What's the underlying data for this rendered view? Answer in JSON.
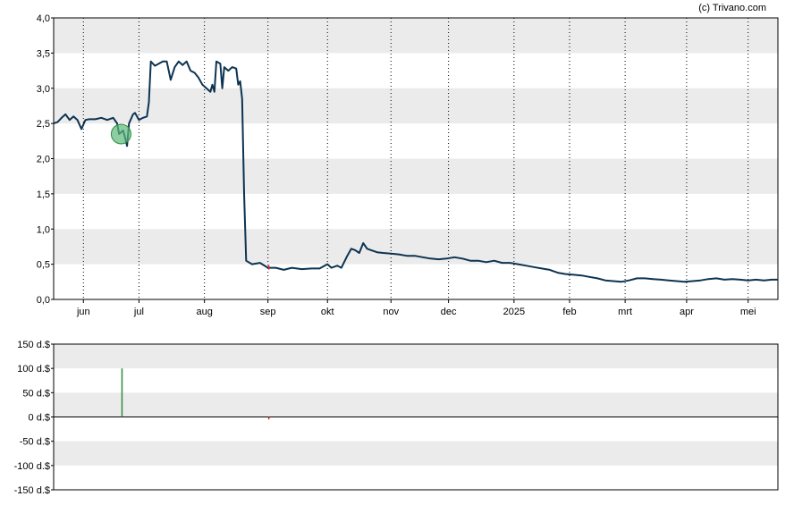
{
  "credit": "(c) Trivano.com",
  "colors": {
    "band": "#ebebeb",
    "price_line": "#0d3451",
    "positive": "#2e8b3d",
    "negative": "#e0242a",
    "marker_fill": "#5cb87a"
  },
  "chart_data": [
    {
      "type": "line",
      "name": "price",
      "ylim": [
        0,
        4
      ],
      "yticks": [
        "0,0",
        "0,5",
        "1,0",
        "1,5",
        "2,0",
        "2,5",
        "3,0",
        "3,5",
        "4,0"
      ],
      "xlim": [
        0,
        365
      ],
      "xticks": [
        {
          "label": "jun",
          "x": 15
        },
        {
          "label": "jul",
          "x": 43
        },
        {
          "label": "aug",
          "x": 76
        },
        {
          "label": "sep",
          "x": 108
        },
        {
          "label": "okt",
          "x": 138
        },
        {
          "label": "nov",
          "x": 170
        },
        {
          "label": "dec",
          "x": 199
        },
        {
          "label": "2025",
          "x": 232
        },
        {
          "label": "feb",
          "x": 260
        },
        {
          "label": "mrt",
          "x": 288
        },
        {
          "label": "apr",
          "x": 319
        },
        {
          "label": "mei",
          "x": 350
        }
      ],
      "grid": "horizontal bands, vertical dotted lines at month ticks",
      "series": [
        {
          "points": [
            [
              0,
              2.5
            ],
            [
              2,
              2.52
            ],
            [
              4,
              2.58
            ],
            [
              6,
              2.63
            ],
            [
              8,
              2.55
            ],
            [
              10,
              2.6
            ],
            [
              12,
              2.55
            ],
            [
              14,
              2.42
            ],
            [
              16,
              2.55
            ],
            [
              18,
              2.56
            ],
            [
              21,
              2.56
            ],
            [
              24,
              2.58
            ],
            [
              27,
              2.55
            ],
            [
              30,
              2.58
            ],
            [
              32,
              2.5
            ],
            [
              33,
              2.35
            ],
            [
              35,
              2.4
            ],
            [
              36,
              2.3
            ],
            [
              37,
              2.18
            ],
            [
              38,
              2.5
            ],
            [
              40,
              2.63
            ],
            [
              41,
              2.65
            ],
            [
              43,
              2.55
            ],
            [
              45,
              2.58
            ],
            [
              47,
              2.6
            ],
            [
              48,
              2.8
            ],
            [
              49,
              3.38
            ],
            [
              51,
              3.32
            ],
            [
              53,
              3.35
            ],
            [
              55,
              3.38
            ],
            [
              57,
              3.38
            ],
            [
              59,
              3.12
            ],
            [
              61,
              3.3
            ],
            [
              63,
              3.38
            ],
            [
              65,
              3.33
            ],
            [
              67,
              3.38
            ],
            [
              69,
              3.25
            ],
            [
              71,
              3.22
            ],
            [
              73,
              3.15
            ],
            [
              75,
              3.05
            ],
            [
              77,
              3.0
            ],
            [
              79,
              2.95
            ],
            [
              80,
              3.05
            ],
            [
              81,
              2.95
            ],
            [
              82,
              3.38
            ],
            [
              84,
              3.35
            ],
            [
              85,
              3.0
            ],
            [
              86,
              3.3
            ],
            [
              88,
              3.25
            ],
            [
              90,
              3.3
            ],
            [
              92,
              3.28
            ],
            [
              93,
              3.05
            ],
            [
              94,
              3.1
            ],
            [
              95,
              2.85
            ],
            [
              96,
              1.5
            ],
            [
              97,
              0.55
            ],
            [
              100,
              0.5
            ],
            [
              104,
              0.52
            ],
            [
              108,
              0.45
            ],
            [
              112,
              0.45
            ],
            [
              116,
              0.42
            ],
            [
              120,
              0.45
            ],
            [
              125,
              0.43
            ],
            [
              130,
              0.44
            ],
            [
              134,
              0.44
            ],
            [
              138,
              0.5
            ],
            [
              140,
              0.45
            ],
            [
              143,
              0.48
            ],
            [
              145,
              0.45
            ],
            [
              148,
              0.62
            ],
            [
              150,
              0.72
            ],
            [
              152,
              0.7
            ],
            [
              154,
              0.66
            ],
            [
              156,
              0.8
            ],
            [
              158,
              0.72
            ],
            [
              160,
              0.7
            ],
            [
              163,
              0.67
            ],
            [
              166,
              0.66
            ],
            [
              170,
              0.65
            ],
            [
              174,
              0.64
            ],
            [
              178,
              0.62
            ],
            [
              182,
              0.62
            ],
            [
              186,
              0.6
            ],
            [
              190,
              0.58
            ],
            [
              194,
              0.57
            ],
            [
              198,
              0.58
            ],
            [
              202,
              0.6
            ],
            [
              206,
              0.58
            ],
            [
              210,
              0.55
            ],
            [
              214,
              0.55
            ],
            [
              218,
              0.53
            ],
            [
              222,
              0.55
            ],
            [
              226,
              0.52
            ],
            [
              230,
              0.52
            ],
            [
              234,
              0.5
            ],
            [
              238,
              0.48
            ],
            [
              242,
              0.46
            ],
            [
              246,
              0.44
            ],
            [
              250,
              0.42
            ],
            [
              254,
              0.38
            ],
            [
              258,
              0.36
            ],
            [
              262,
              0.35
            ],
            [
              266,
              0.34
            ],
            [
              270,
              0.32
            ],
            [
              274,
              0.3
            ],
            [
              278,
              0.27
            ],
            [
              282,
              0.26
            ],
            [
              286,
              0.25
            ],
            [
              290,
              0.27
            ],
            [
              294,
              0.3
            ],
            [
              298,
              0.3
            ],
            [
              302,
              0.29
            ],
            [
              306,
              0.28
            ],
            [
              310,
              0.27
            ],
            [
              314,
              0.26
            ],
            [
              318,
              0.25
            ],
            [
              322,
              0.26
            ],
            [
              326,
              0.27
            ],
            [
              330,
              0.29
            ],
            [
              334,
              0.3
            ],
            [
              338,
              0.28
            ],
            [
              342,
              0.29
            ],
            [
              346,
              0.28
            ],
            [
              350,
              0.27
            ],
            [
              354,
              0.28
            ],
            [
              358,
              0.27
            ],
            [
              362,
              0.28
            ],
            [
              365,
              0.28
            ]
          ]
        }
      ],
      "markers": [
        {
          "x": 34,
          "y": 2.35
        }
      ]
    },
    {
      "type": "bar",
      "name": "transactions",
      "ylim": [
        -150,
        150
      ],
      "yticks": [
        "150 d.$",
        "100 d.$",
        "50 d.$",
        "0 d.$",
        "-50 d.$",
        "-100 d.$",
        "-150 d.$"
      ],
      "bars": [
        {
          "x": 34,
          "value": 100
        },
        {
          "x": 108,
          "value": -5
        }
      ]
    }
  ]
}
